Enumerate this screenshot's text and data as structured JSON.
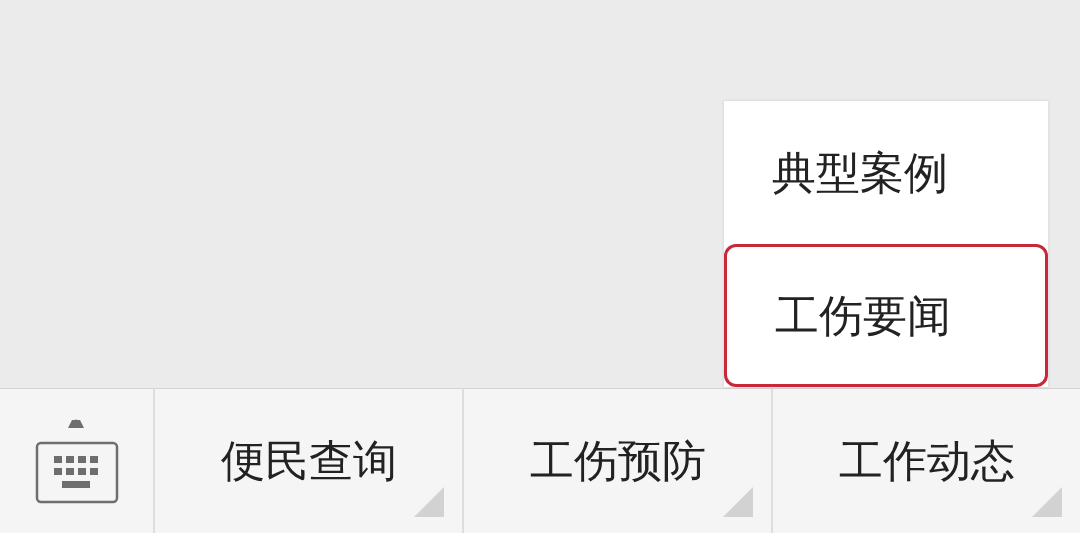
{
  "menu_bar": {
    "items": [
      {
        "label": "便民查询",
        "has_submenu": true
      },
      {
        "label": "工伤预防",
        "has_submenu": true
      },
      {
        "label": "工作动态",
        "has_submenu": true,
        "submenu": [
          {
            "label": "典型案例",
            "selected": false
          },
          {
            "label": "工伤要闻",
            "selected": true
          }
        ]
      }
    ]
  }
}
